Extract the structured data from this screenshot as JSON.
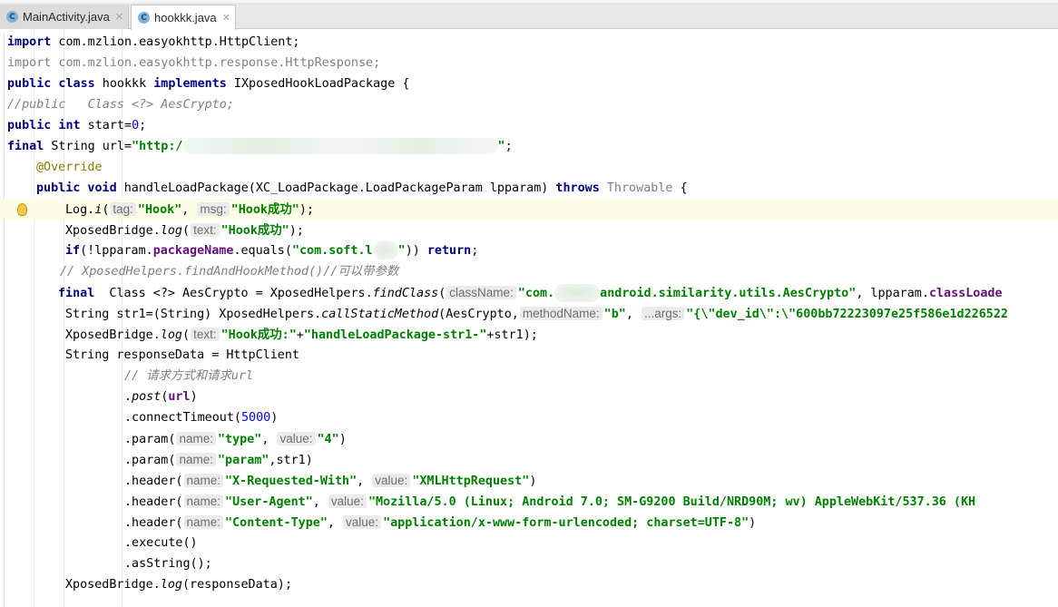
{
  "tabs": [
    {
      "label": "MainActivity.java",
      "icon": "java-class-icon",
      "active": false
    },
    {
      "label": "hookkk.java",
      "icon": "java-class-icon",
      "active": true
    }
  ],
  "code": {
    "l1": {
      "kw": "import",
      "rest": " com.mzlion.easyokhttp.HttpClient;"
    },
    "l2": {
      "text": "import com.mzlion.easyokhttp.response.HttpResponse;"
    },
    "l3": {
      "kw1": "public class",
      "name": " hookkk ",
      "kw2": "implements",
      "rest": " IXposedHookLoadPackage {"
    },
    "l4": {
      "text": "//public   Class <?> AesCrypto;"
    },
    "l5": {
      "kw": "public int",
      "mid": " start=",
      "num": "0",
      "end": ";"
    },
    "l6": {
      "kw": "final",
      "mid": " String url=",
      "str1": "\"http:/",
      "str2": "\"",
      "end": ";"
    },
    "l7": {
      "text": "@Override"
    },
    "l8": {
      "kw": "public void",
      "mid": " handleLoadPackage(XC_LoadPackage.LoadPackageParam lpparam) ",
      "kw2": "throws",
      "gray": " Throwable",
      "end": " {"
    },
    "l9": {
      "pre": "Log.",
      "method": "i",
      "open": "(",
      "hint1": "tag:",
      "str1": "\"Hook\"",
      "comma": ", ",
      "hint2": "msg:",
      "str2": "\"Hook成功\"",
      "end": ");"
    },
    "l10": {
      "pre": "XposedBridge.",
      "method": "log",
      "open": "(",
      "hint": "text:",
      "str": "\"Hook成功\"",
      "end": ");"
    },
    "l11": {
      "kw": "if",
      "pre": "(!lpparam.",
      "field": "packageName",
      "mid": ".equals(",
      "str1": "\"com.soft.l",
      "str2": "\"",
      "mid2": ")) ",
      "kw2": "return",
      "end": ";"
    },
    "l12": {
      "text": "// XposedHelpers.findAndHookMethod()//可以带参数"
    },
    "l13": {
      "kw": "final",
      "mid": "  Class <?> AesCrypto = XposedHelpers.",
      "method": "findClass",
      "open": "(",
      "hint": "className:",
      "str1": "\"com.",
      "str2": "android.similarity.utils.AesCrypto\"",
      "mid2": ", lpparam.",
      "field": "classLoade"
    },
    "l14": {
      "pre": "String str1=(String) XposedHelpers.",
      "method": "callStaticMethod",
      "open": "(AesCrypto,",
      "hint1": "methodName:",
      "str1": "\"b\"",
      "comma": ", ",
      "hint2": "...args:",
      "str2": "\"{\\\"dev_id\\\":\\\"600bb72223097e25f586e1d226522"
    },
    "l15": {
      "pre": "XposedBridge.",
      "method": "log",
      "open": "(",
      "hint": "text:",
      "str1": "\"Hook成功:\"",
      "plus": "+",
      "str2": "\"handleLoadPackage-str1-\"",
      "end": "+str1);"
    },
    "l16": {
      "text": "String responseData = HttpClient"
    },
    "l17": {
      "text": "// 请求方式和请求url"
    },
    "l18": {
      "pre": ".",
      "method": "post",
      "open": "(",
      "field": "url",
      "end": ")"
    },
    "l19": {
      "pre": ".connectTimeout(",
      "num": "5000",
      "end": ")"
    },
    "l20": {
      "pre": ".param(",
      "hint1": "name:",
      "str1": "\"type\"",
      "comma": ", ",
      "hint2": "value:",
      "str2": "\"4\"",
      "end": ")"
    },
    "l21": {
      "pre": ".param(",
      "hint": "name:",
      "str": "\"param\"",
      "end": ",str1)"
    },
    "l22": {
      "pre": ".header(",
      "hint1": "name:",
      "str1": "\"X-Requested-With\"",
      "comma": ", ",
      "hint2": "value:",
      "str2": "\"XMLHttpRequest\"",
      "end": ")"
    },
    "l23": {
      "pre": ".header(",
      "hint1": "name:",
      "str1": "\"User-Agent\"",
      "comma": ", ",
      "hint2": "value:",
      "str2": "\"Mozilla/5.0 (Linux; Android 7.0; SM-G9200 Build/NRD90M; wv) AppleWebKit/537.36 (KH"
    },
    "l24": {
      "pre": ".header(",
      "hint1": "name:",
      "str1": "\"Content-Type\"",
      "comma": ", ",
      "hint2": "value:",
      "str2": "\"application/x-www-form-urlencoded; charset=UTF-8\"",
      "end": ")"
    },
    "l25": {
      "text": ".execute()"
    },
    "l26": {
      "text": ".asString();"
    },
    "l27": {
      "pre": "XposedBridge.",
      "method": "log",
      "end": "(responseData);"
    }
  },
  "colors": {
    "keyword": "#000080",
    "string": "#008000",
    "comment": "#808080",
    "annotation": "#808000",
    "field": "#660e7a",
    "number": "#0000ff"
  }
}
